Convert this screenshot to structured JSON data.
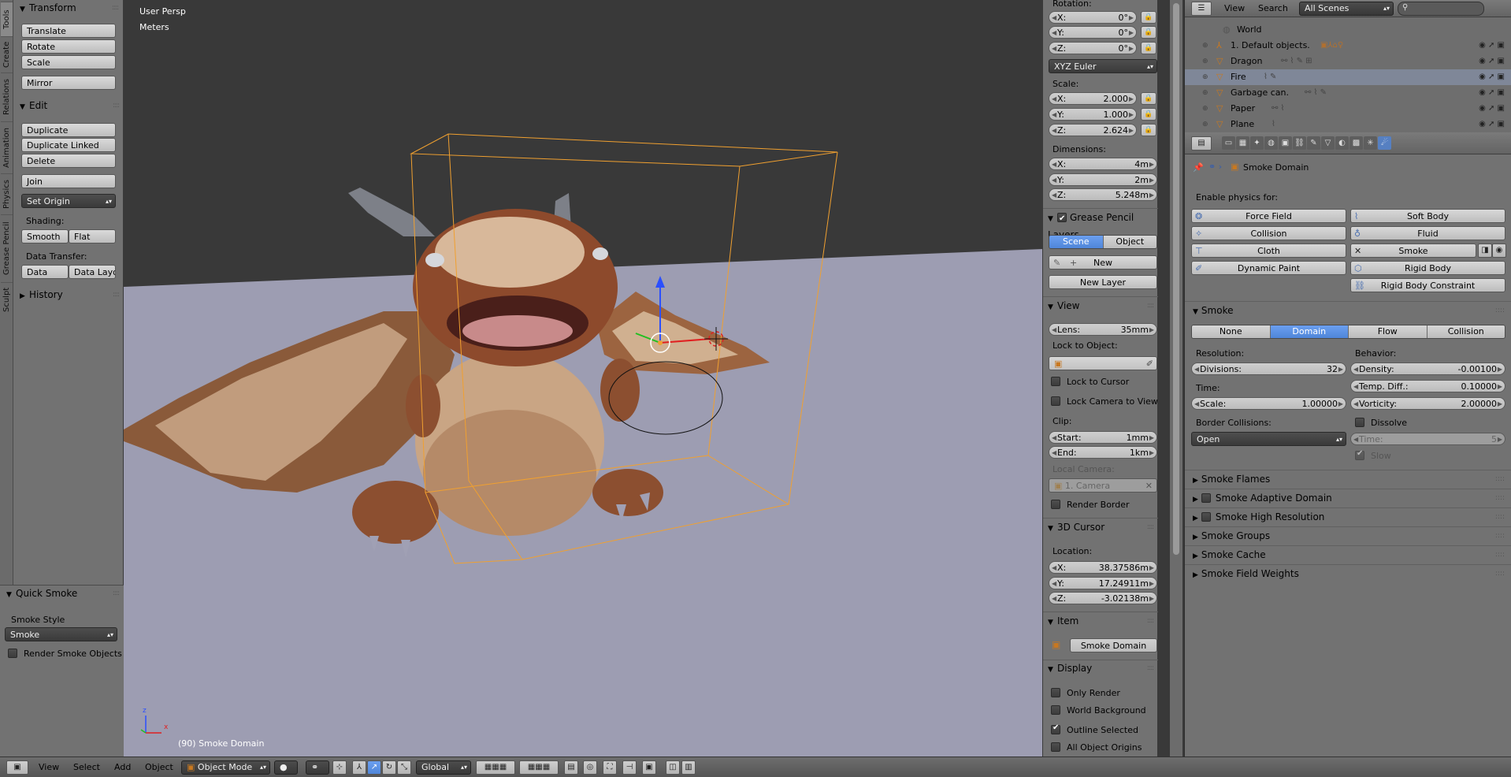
{
  "left_tabs": [
    "Tools",
    "Create",
    "Relations",
    "Animation",
    "Physics",
    "Grease Pencil",
    "Sculpt"
  ],
  "tool_shelf": {
    "transform": {
      "title": "Transform",
      "buttons": [
        "Translate",
        "Rotate",
        "Scale",
        "Mirror"
      ]
    },
    "edit": {
      "title": "Edit",
      "buttons": [
        "Duplicate",
        "Duplicate Linked",
        "Delete",
        "Join"
      ],
      "set_origin": "Set Origin",
      "shading_label": "Shading:",
      "smooth": "Smooth",
      "flat": "Flat",
      "data_transfer_label": "Data Transfer:",
      "data": "Data",
      "data_layout": "Data Layo"
    },
    "history": {
      "title": "History"
    },
    "quick_smoke": {
      "title": "Quick Smoke",
      "style_label": "Smoke Style",
      "style_value": "Smoke",
      "render_objects": "Render Smoke Objects"
    }
  },
  "viewport": {
    "persp": "User Persp",
    "units": "Meters",
    "status": "(90) Smoke Domain",
    "axis_x": "x",
    "axis_z": "z"
  },
  "n_panel": {
    "rotation_label": "Rotation:",
    "rotation": [
      {
        "k": "X:",
        "v": "0°"
      },
      {
        "k": "Y:",
        "v": "0°"
      },
      {
        "k": "Z:",
        "v": "0°"
      }
    ],
    "rotation_mode": "XYZ Euler",
    "scale_label": "Scale:",
    "scale": [
      {
        "k": "X:",
        "v": "2.000"
      },
      {
        "k": "Y:",
        "v": "1.000"
      },
      {
        "k": "Z:",
        "v": "2.624"
      }
    ],
    "dimensions_label": "Dimensions:",
    "dimensions": [
      {
        "k": "X:",
        "v": "4m"
      },
      {
        "k": "Y:",
        "v": "2m"
      },
      {
        "k": "Z:",
        "v": "5.248m"
      }
    ],
    "grease_pencil": {
      "title": "Grease Pencil Layers",
      "scene": "Scene",
      "object": "Object",
      "new": "New",
      "new_layer": "New Layer"
    },
    "view": {
      "title": "View",
      "lens_label": "Lens:",
      "lens": "35mm",
      "lock_to_object": "Lock to Object:",
      "lock_to_cursor": "Lock to Cursor",
      "lock_camera": "Lock Camera to View",
      "clip_label": "Clip:",
      "start_label": "Start:",
      "start": "1mm",
      "end_label": "End:",
      "end": "1km",
      "local_camera": "Local Camera:",
      "camera": "1. Camera",
      "render_border": "Render Border"
    },
    "cursor": {
      "title": "3D Cursor",
      "location_label": "Location:",
      "location": [
        {
          "k": "X:",
          "v": "38.37586m"
        },
        {
          "k": "Y:",
          "v": "17.24911m"
        },
        {
          "k": "Z:",
          "v": "-3.02138m"
        }
      ]
    },
    "item": {
      "title": "Item",
      "name": "Smoke Domain"
    },
    "display": {
      "title": "Display",
      "only_render": "Only Render",
      "world_bg": "World Background",
      "outline_sel": "Outline Selected",
      "all_origins": "All Object Origins"
    }
  },
  "outliner": {
    "menu": [
      "View",
      "Search"
    ],
    "scene_select": "All Scenes",
    "rows": [
      "World",
      "1. Default objects.",
      "Dragon",
      "Fire",
      "Garbage can.",
      "Paper",
      "Plane"
    ]
  },
  "properties": {
    "breadcrumb": "Smoke Domain",
    "enable_label": "Enable physics for:",
    "physics_left": [
      "Force Field",
      "Collision",
      "Cloth",
      "Dynamic Paint"
    ],
    "physics_right": [
      "Soft Body",
      "Fluid",
      "Smoke",
      "Rigid Body",
      "Rigid Body Constraint"
    ],
    "smoke": {
      "title": "Smoke",
      "types": [
        "None",
        "Domain",
        "Flow",
        "Collision"
      ],
      "resolution_label": "Resolution:",
      "divisions_label": "Divisions:",
      "divisions": "32",
      "time_label": "Time:",
      "scale_label": "Scale:",
      "scale": "1.00000",
      "border_label": "Border Collisions:",
      "border_value": "Open",
      "behavior_label": "Behavior:",
      "density_label": "Density:",
      "density": "-0.00100",
      "temp_label": "Temp. Diff.:",
      "temp": "0.10000",
      "vorticity_label": "Vorticity:",
      "vorticity": "2.00000",
      "dissolve": "Dissolve",
      "dtime_label": "Time:",
      "dtime": "5",
      "slow": "Slow"
    },
    "subpanels": [
      "Smoke Flames",
      "Smoke Adaptive Domain",
      "Smoke High Resolution",
      "Smoke Groups",
      "Smoke Cache",
      "Smoke Field Weights"
    ]
  },
  "bottom_bar": {
    "menu": [
      "View",
      "Select",
      "Add",
      "Object"
    ],
    "mode": "Object Mode",
    "orientation": "Global"
  },
  "colors": {
    "selection": "#f0a030",
    "accent": "#5680c2",
    "ground": "#9d9db2",
    "sky": "#393939"
  }
}
